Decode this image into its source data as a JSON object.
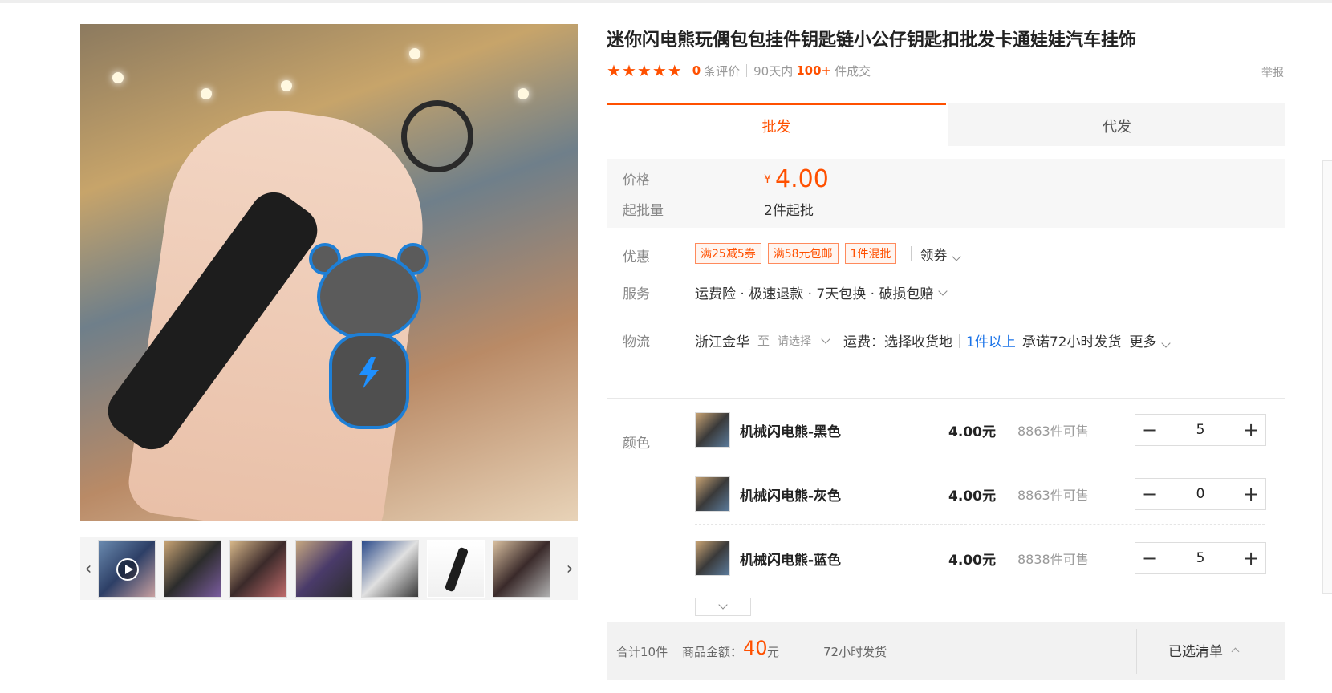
{
  "product": {
    "title": "迷你闪电熊玩偶包包挂件钥匙链小公仔钥匙扣批发卡通娃娃汽车挂饰",
    "rating_count": "0",
    "rating_label": "条评价",
    "deal_prefix": "90天内",
    "deal_count": "100+",
    "deal_suffix": "件成交",
    "report_label": "举报"
  },
  "tabs": [
    {
      "label": "批发",
      "active": true
    },
    {
      "label": "代发",
      "active": false
    }
  ],
  "price": {
    "label": "价格",
    "currency": "¥",
    "value": "4.00",
    "moq_label": "起批量",
    "moq_value": "2件起批"
  },
  "promo": {
    "label": "优惠",
    "coupons": [
      "满25减5券",
      "满58元包邮",
      "1件混批"
    ],
    "get_coupon": "领券"
  },
  "service": {
    "label": "服务",
    "text": "运费险 · 极速退款 · 7天包换 · 破损包赔"
  },
  "logistics": {
    "label": "物流",
    "origin": "浙江金华",
    "to": "至",
    "select": "请选择",
    "freight": "运费：选择收货地",
    "qty_rule": "1件以上",
    "promise": "承诺72小时发货",
    "more": "更多"
  },
  "sku": {
    "label": "颜色",
    "items": [
      {
        "name": "机械闪电熊-黑色",
        "price": "4.00元",
        "stock": "8863件可售",
        "qty": "5"
      },
      {
        "name": "机械闪电熊-灰色",
        "price": "4.00元",
        "stock": "8863件可售",
        "qty": "0"
      },
      {
        "name": "机械闪电熊-蓝色",
        "price": "4.00元",
        "stock": "8838件可售",
        "qty": "5"
      }
    ]
  },
  "summary": {
    "total_items": "合计10件",
    "amount_label": "商品金额：",
    "amount": "40",
    "amount_unit": "元",
    "ship": "72小时发货",
    "selected_list": "已选清单"
  },
  "gallery": {
    "thumbnails": [
      "video-thumb",
      "thumb-2",
      "thumb-3",
      "thumb-4",
      "thumb-5",
      "thumb-6",
      "thumb-7"
    ]
  },
  "colors": {
    "accent": "#ff5000",
    "link": "#1a73e8"
  }
}
